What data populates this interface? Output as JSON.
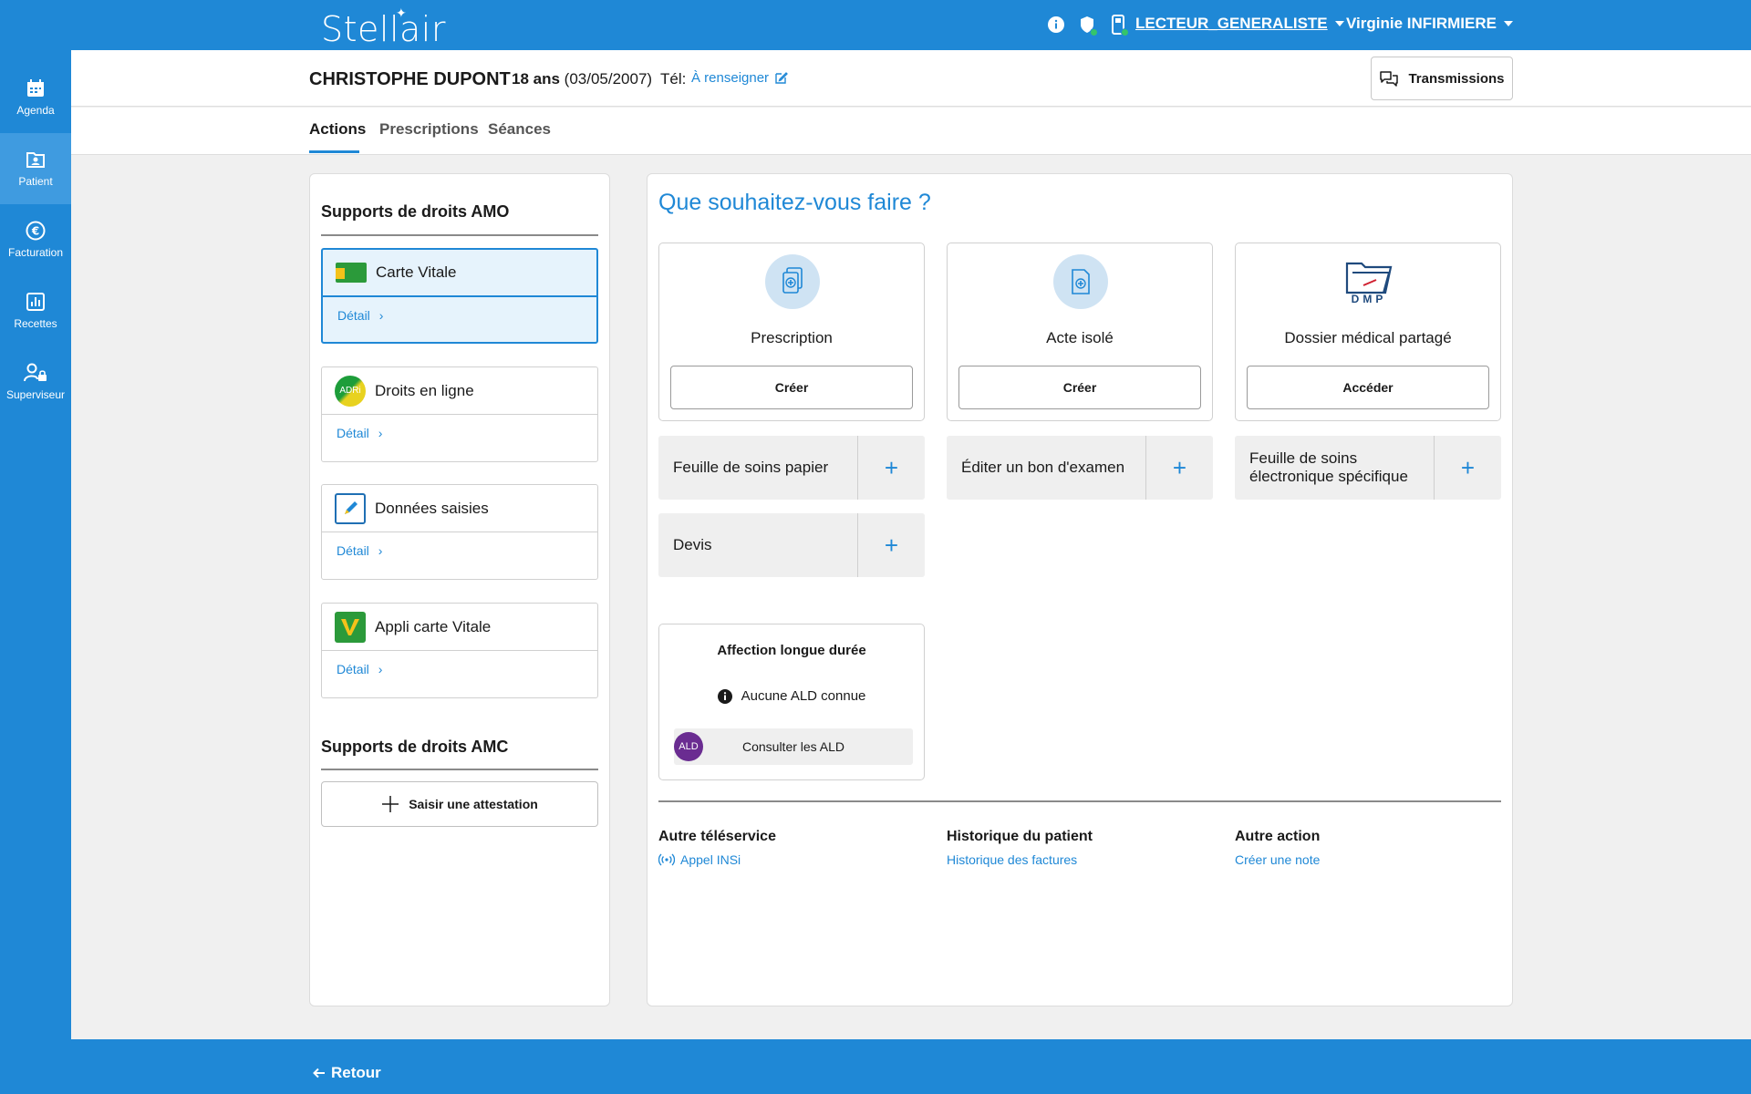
{
  "app": {
    "logo": "Stellair"
  },
  "header": {
    "reader": "LECTEUR_GENERALISTE",
    "user": "Virginie INFIRMIERE",
    "icons": [
      "info-icon",
      "shield-icon",
      "card-reader-icon"
    ]
  },
  "sidebar": {
    "items": [
      {
        "label": "Agenda",
        "icon": "calendar-icon"
      },
      {
        "label": "Patient",
        "icon": "patient-folder-icon"
      },
      {
        "label": "Facturation",
        "icon": "euro-icon"
      },
      {
        "label": "Recettes",
        "icon": "chart-icon"
      },
      {
        "label": "Superviseur",
        "icon": "user-lock-icon"
      }
    ]
  },
  "patient": {
    "name": "CHRISTOPHE DUPONT",
    "age": "18 ans",
    "dob": "(03/05/2007)",
    "tel_label": "Tél:",
    "tel_value": "À renseigner"
  },
  "transmissions_label": "Transmissions",
  "tabs": [
    {
      "label": "Actions"
    },
    {
      "label": "Prescriptions"
    },
    {
      "label": "Séances"
    }
  ],
  "left": {
    "amo_title": "Supports de droits AMO",
    "supports": [
      {
        "label": "Carte Vitale",
        "detail": "Détail"
      },
      {
        "label": "Droits en ligne",
        "detail": "Détail"
      },
      {
        "label": "Données saisies",
        "detail": "Détail"
      },
      {
        "label": "Appli carte Vitale",
        "detail": "Détail"
      }
    ],
    "amc_title": "Supports de droits AMC",
    "saisir_label": "Saisir une attestation"
  },
  "right": {
    "question": "Que souhaitez-vous faire ?",
    "cards": [
      {
        "title": "Prescription",
        "button": "Créer"
      },
      {
        "title": "Acte isolé",
        "button": "Créer"
      },
      {
        "title": "Dossier médical partagé",
        "button": "Accéder",
        "logo_text": "DMP"
      }
    ],
    "quick_actions": [
      {
        "label": "Feuille de soins papier"
      },
      {
        "label": "Éditer un bon d'examen"
      },
      {
        "label": "Feuille de soins électronique spécifique"
      },
      {
        "label": "Devis"
      }
    ],
    "plus": "+",
    "ald": {
      "title": "Affection longue durée",
      "note": "Aucune ALD connue",
      "button": "Consulter les ALD",
      "logo_text": "ALD"
    },
    "bottom": [
      {
        "title": "Autre téléservice",
        "link": "Appel INSi"
      },
      {
        "title": "Historique du patient",
        "link": "Historique des factures"
      },
      {
        "title": "Autre action",
        "link": "Créer une note"
      }
    ]
  },
  "footer": {
    "back_label": "Retour"
  },
  "colors": {
    "primary": "#1f88d6",
    "link": "#1f88d6",
    "card_bg": "#efefef",
    "selected_bg": "#e6f3fc"
  }
}
